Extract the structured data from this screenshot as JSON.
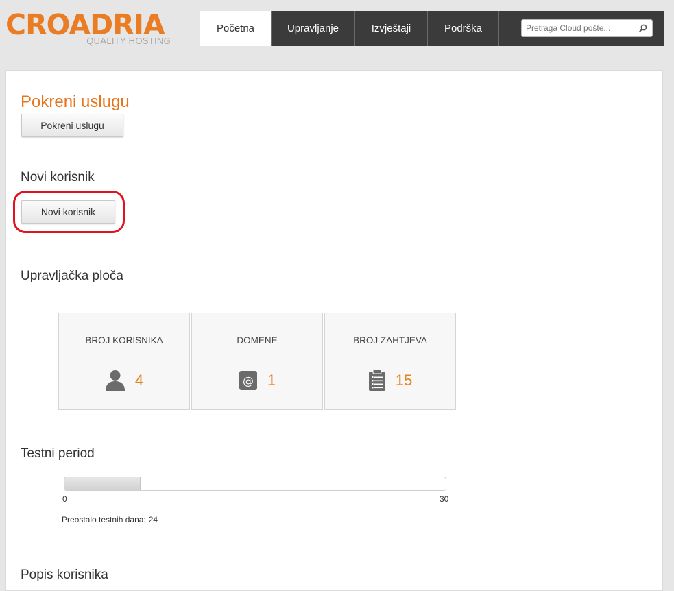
{
  "header": {
    "logo_text": "CROADRIA",
    "logo_subtext": "QUALITY HOSTING",
    "nav": [
      {
        "label": "Početna",
        "active": true
      },
      {
        "label": "Upravljanje",
        "active": false
      },
      {
        "label": "Izvještaji",
        "active": false
      },
      {
        "label": "Podrška",
        "active": false
      }
    ],
    "search": {
      "placeholder": "Pretraga Cloud pošte...",
      "value": "",
      "icon": "search-icon"
    }
  },
  "sections": {
    "start_service": {
      "title": "Pokreni uslugu",
      "button_label": "Pokreni uslugu"
    },
    "new_user": {
      "title": "Novi korisnik",
      "button_label": "Novi korisnik"
    },
    "dashboard": {
      "title": "Upravljačka ploča",
      "stats": [
        {
          "label": "BROJ KORISNIKA",
          "value": "4",
          "icon": "user-icon"
        },
        {
          "label": "DOMENE",
          "value": "1",
          "icon": "at-sign-icon"
        },
        {
          "label": "BROJ ZAHTJEVA",
          "value": "15",
          "icon": "clipboard-icon"
        }
      ]
    },
    "trial": {
      "title": "Testni period",
      "min_label": "0",
      "max_label": "30",
      "progress_fraction": 0.2,
      "remaining_label": "Preostalo testnih dana:",
      "remaining_value": "24"
    },
    "user_list": {
      "title": "Popis korisnika"
    }
  },
  "colors": {
    "accent": "#e8741c",
    "nav_dark": "#3b3b3b",
    "highlight_ring": "#e0141e"
  }
}
